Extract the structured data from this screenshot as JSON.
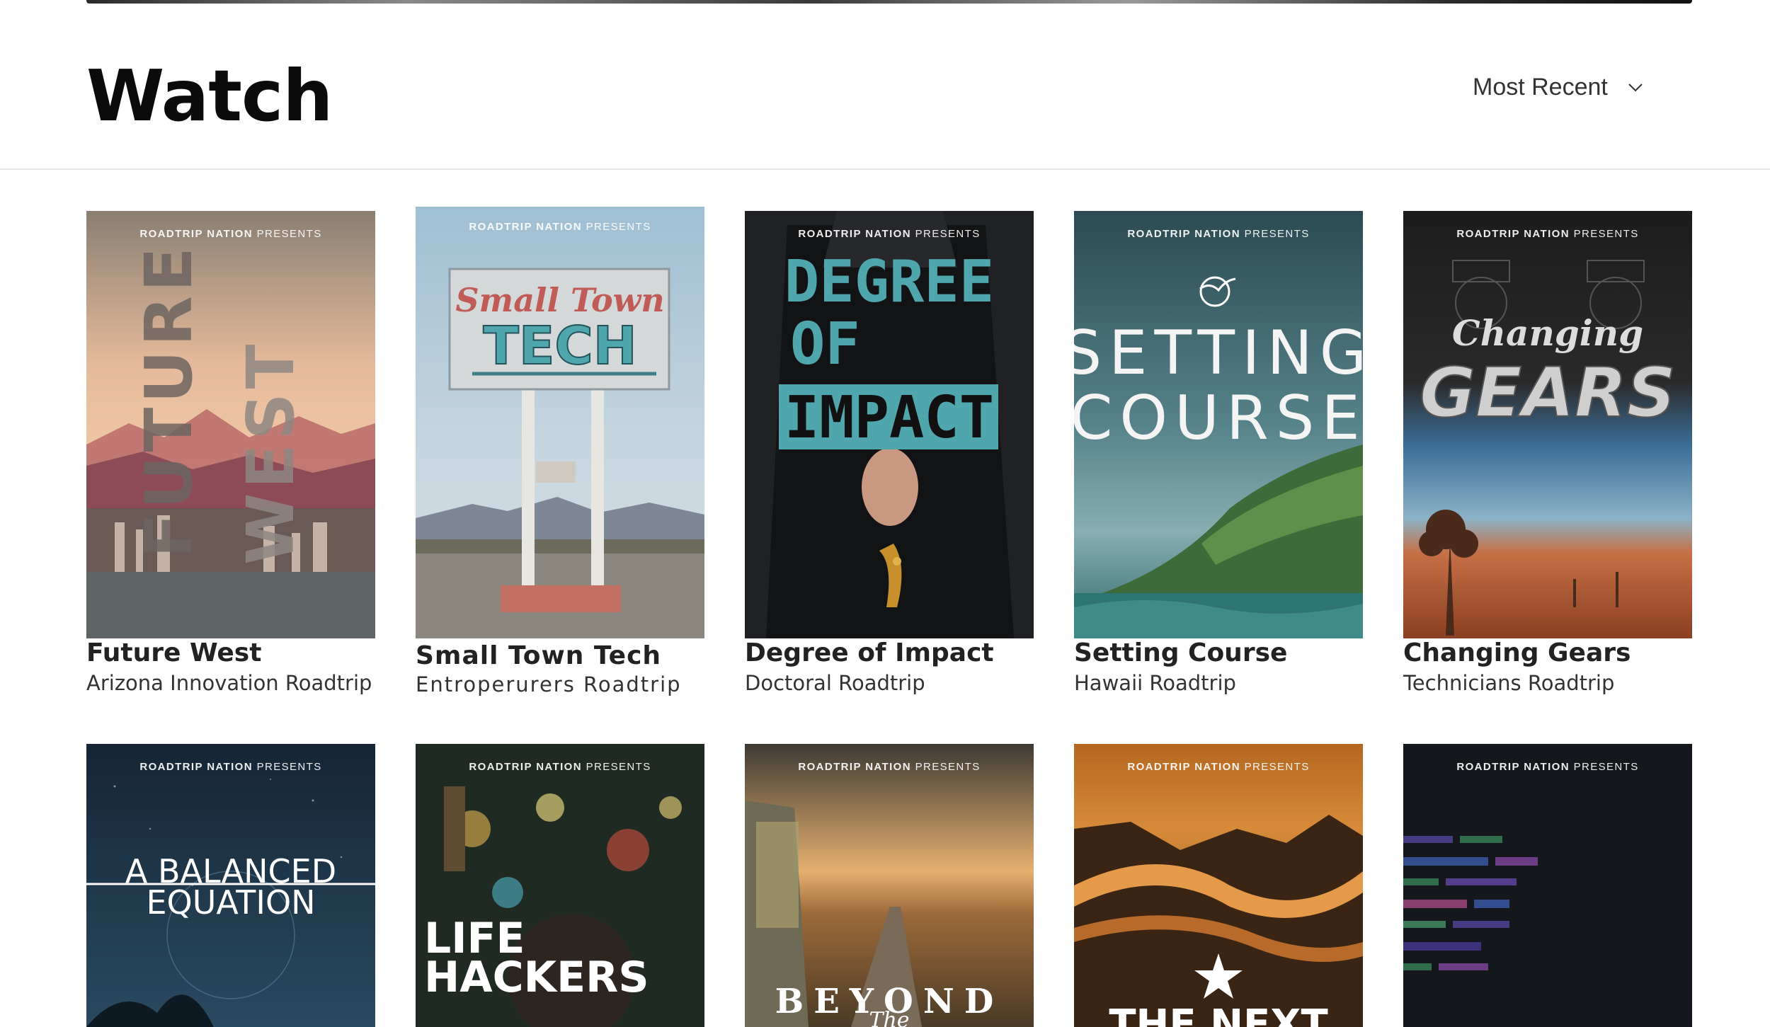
{
  "header": {
    "title": "Watch",
    "sort_label": "Most Recent"
  },
  "poster_brand": {
    "bold": "ROADTRIP NATION",
    "light": "PRESENTS"
  },
  "row1": [
    {
      "title": "Future West",
      "subtitle": "Arizona Innovation Roadtrip",
      "poster_text": [
        "FUTURE",
        "WEST"
      ]
    },
    {
      "title": "Small Town Tech",
      "subtitle": "Entroperurers Roadtrip",
      "poster_text": [
        "Small Town",
        "TECH"
      ]
    },
    {
      "title": "Degree of Impact",
      "subtitle": "Doctoral Roadtrip",
      "poster_text": [
        "DEGREE",
        "OF",
        "IMPACT"
      ]
    },
    {
      "title": "Setting Course",
      "subtitle": "Hawaii Roadtrip",
      "poster_text": [
        "SETTING",
        "COURSE"
      ]
    },
    {
      "title": "Changing Gears",
      "subtitle": "Technicians Roadtrip",
      "poster_text": [
        "Changing",
        "GEARS"
      ]
    }
  ],
  "row2": [
    {
      "poster_text": [
        "A BALANCED",
        "EQUATION"
      ]
    },
    {
      "poster_text": [
        "LIFE",
        "HACKERS"
      ]
    },
    {
      "poster_text": [
        "BEYOND",
        "The"
      ]
    },
    {
      "poster_text": [
        "THE NEXT"
      ]
    },
    {
      "poster_text": []
    }
  ],
  "colors": {
    "accent_teal": "#4fa7ad",
    "title_text": "#222222"
  }
}
